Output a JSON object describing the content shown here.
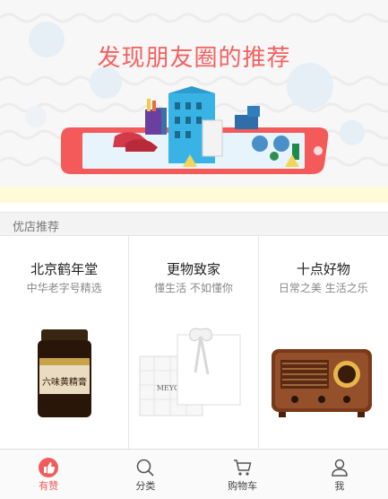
{
  "banner": {
    "title": "发现朋友圈的推荐"
  },
  "section": {
    "title": "优店推荐"
  },
  "shops": [
    {
      "name": "北京鹤年堂",
      "desc": "中华老字号精选",
      "product_label": "六味黄精膏"
    },
    {
      "name": "更物致家",
      "desc": "懂生活 不如懂你",
      "product_label": "MEYOU"
    },
    {
      "name": "十点好物",
      "desc": "日常之美 生活之乐",
      "product_label": ""
    }
  ],
  "tabbar": {
    "items": [
      {
        "label": "有赞",
        "icon": "thumbs-up-icon",
        "active": true
      },
      {
        "label": "分类",
        "icon": "search-icon",
        "active": false
      },
      {
        "label": "购物车",
        "icon": "cart-icon",
        "active": false
      },
      {
        "label": "我",
        "icon": "user-icon",
        "active": false
      }
    ]
  },
  "colors": {
    "accent": "#f25b5b",
    "banner_title": "#f46060",
    "strip": "#fffbd6"
  }
}
